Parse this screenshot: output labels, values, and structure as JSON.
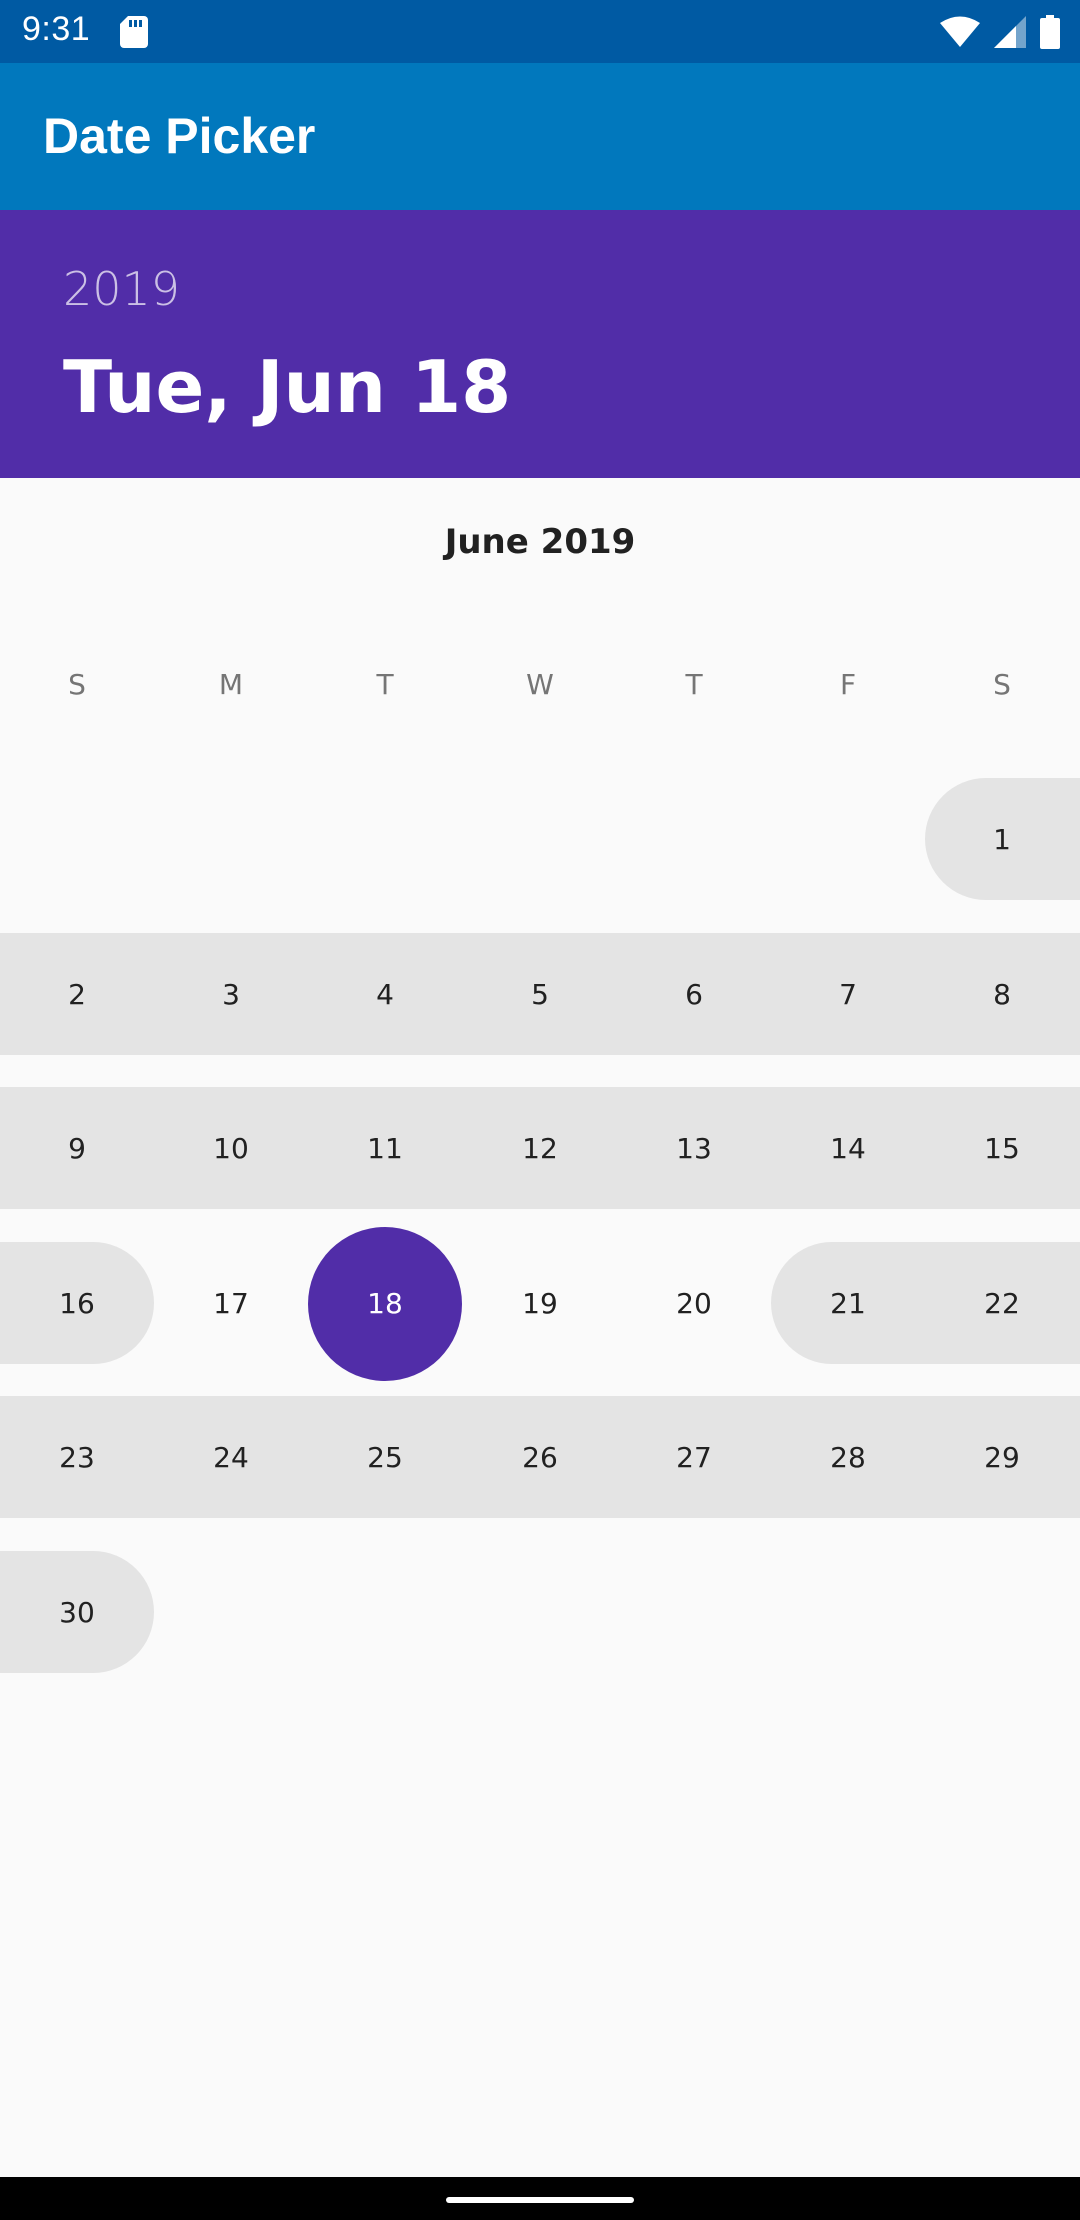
{
  "status_bar": {
    "time": "9:31",
    "icons": [
      "sd-card-icon",
      "wifi-icon",
      "signal-icon",
      "battery-icon"
    ]
  },
  "app_bar": {
    "title": "Date Picker",
    "color": "#0178bd"
  },
  "picker": {
    "accent_color": "#512da8",
    "header_year": "2019",
    "header_date": "Tue, Jun 18",
    "month_title": "June 2019",
    "weekdays": [
      "S",
      "M",
      "T",
      "W",
      "T",
      "F",
      "S"
    ],
    "selected_day": "18",
    "days": [
      "1",
      "2",
      "3",
      "4",
      "5",
      "6",
      "7",
      "8",
      "9",
      "10",
      "11",
      "12",
      "13",
      "14",
      "15",
      "16",
      "17",
      "18",
      "19",
      "20",
      "21",
      "22",
      "23",
      "24",
      "25",
      "26",
      "27",
      "28",
      "29",
      "30"
    ]
  }
}
